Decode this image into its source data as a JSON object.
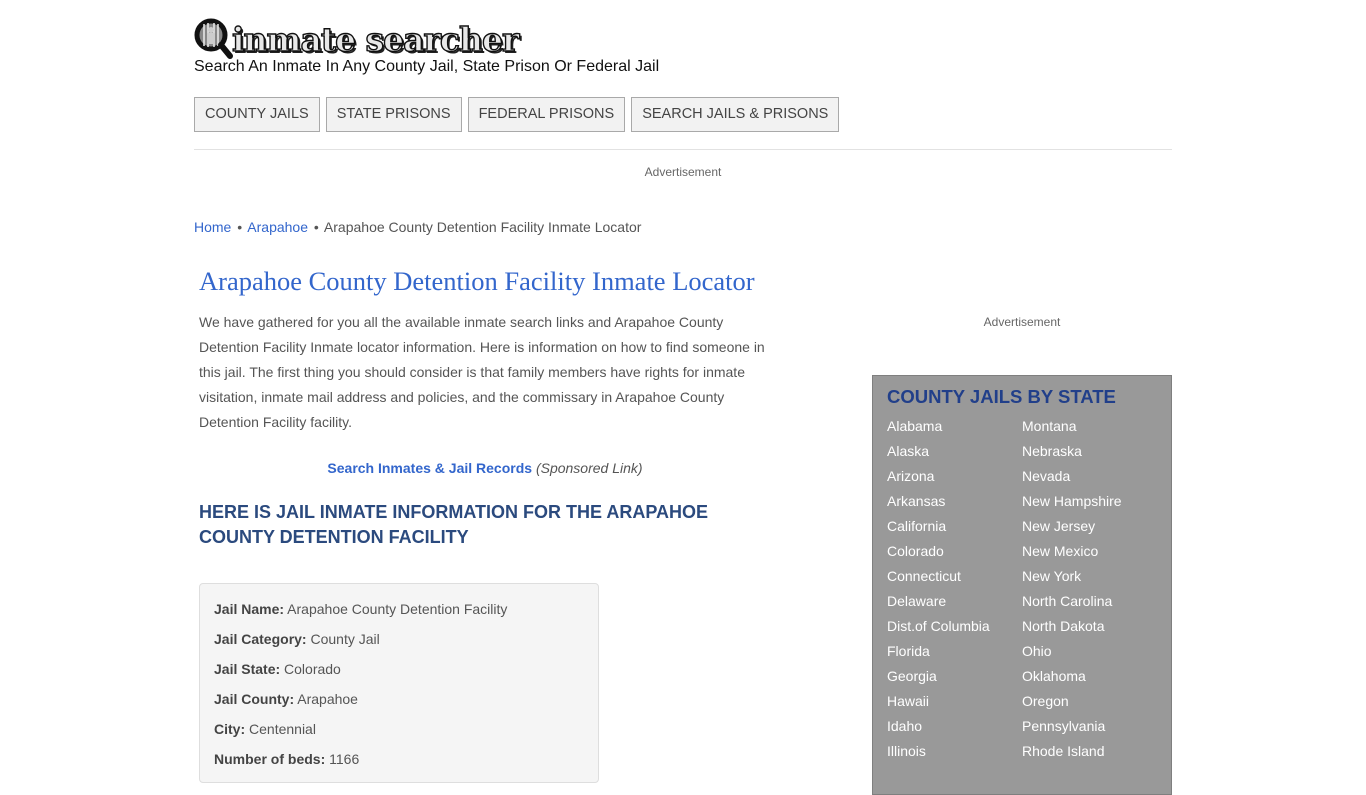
{
  "header": {
    "logo_text": "inmate searcher",
    "logo_icon": "magnifier-inmate-icon",
    "tagline": "Search An Inmate In Any County Jail, State Prison Or Federal Jail"
  },
  "nav": {
    "items": [
      {
        "label": "COUNTY JAILS"
      },
      {
        "label": "STATE PRISONS"
      },
      {
        "label": "FEDERAL PRISONS"
      },
      {
        "label": "SEARCH JAILS & PRISONS"
      }
    ]
  },
  "ads": {
    "top_label": "Advertisement",
    "side_label": "Advertisement"
  },
  "breadcrumb": {
    "items": [
      {
        "label": "Home",
        "link": true
      },
      {
        "label": "Arapahoe",
        "link": true
      },
      {
        "label": "Arapahoe County Detention Facility Inmate Locator",
        "link": false
      }
    ],
    "separator": "•"
  },
  "main": {
    "title": "Arapahoe County Detention Facility Inmate Locator",
    "intro": "We have gathered for you all the available inmate search links and Arapahoe County Detention Facility Inmate locator information. Here is information on how to find someone in this jail. The first thing you should consider is that family members have rights for inmate visitation, inmate mail address and policies, and the commissary in Arapahoe County Detention Facility facility.",
    "sponsored_link": "Search Inmates & Jail Records",
    "sponsored_note": "(Sponsored Link)",
    "section_heading": "HERE IS JAIL INMATE INFORMATION FOR THE ARAPAHOE COUNTY DETENTION FACILITY",
    "info": [
      {
        "label": "Jail Name:",
        "value": "Arapahoe County Detention Facility"
      },
      {
        "label": "Jail Category:",
        "value": "County Jail"
      },
      {
        "label": "Jail State:",
        "value": "Colorado"
      },
      {
        "label": "Jail County:",
        "value": "Arapahoe"
      },
      {
        "label": "City:",
        "value": "Centennial"
      },
      {
        "label": "Number of beds:",
        "value": "1166"
      }
    ]
  },
  "sidebar": {
    "heading": "COUNTY JAILS BY STATE",
    "col1": [
      "Alabama",
      "Alaska",
      "Arizona",
      "Arkansas",
      "California",
      "Colorado",
      "Connecticut",
      "Delaware",
      "Dist.of Columbia",
      "Florida",
      "Georgia",
      "Hawaii",
      "Idaho",
      "Illinois"
    ],
    "col2": [
      "Montana",
      "Nebraska",
      "Nevada",
      "New Hampshire",
      "New Jersey",
      "New Mexico",
      "New York",
      "North Carolina",
      "North Dakota",
      "Ohio",
      "Oklahoma",
      "Oregon",
      "Pennsylvania",
      "Rhode Island"
    ]
  },
  "colors": {
    "link": "#3366cc",
    "heading_dark": "#2b4a7e",
    "sidebar_bg": "#999999",
    "sidebar_heading": "#213f8a"
  }
}
